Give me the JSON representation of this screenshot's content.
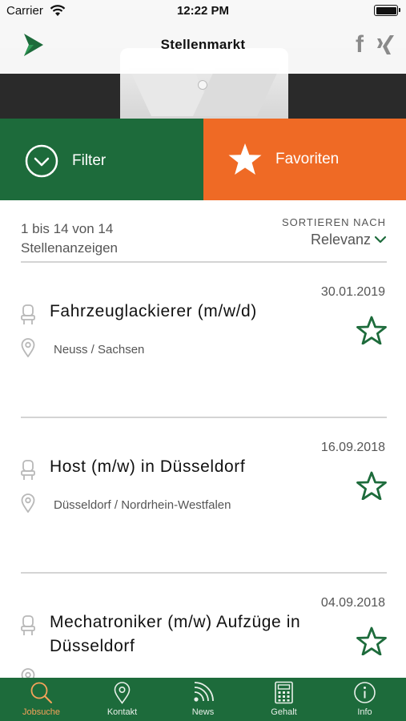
{
  "status_bar": {
    "carrier": "Carrier",
    "time": "12:22 PM"
  },
  "header": {
    "title": "Stellenmarkt",
    "facebook_glyph": "f"
  },
  "actions": {
    "filter_label": "Filter",
    "favorites_label": "Favoriten"
  },
  "summary": {
    "count_line1": "1 bis 14 von 14",
    "count_line2": "Stellenanzeigen",
    "sort_caption": "SORTIEREN NACH",
    "sort_value": "Relevanz"
  },
  "jobs": [
    {
      "date": "30.01.2019",
      "title": "Fahrzeuglackierer (m/w/d)",
      "location": "Neuss / Sachsen"
    },
    {
      "date": "16.09.2018",
      "title": "Host (m/w) in Düsseldorf",
      "location": "Düsseldorf / Nordrhein-Westfalen"
    },
    {
      "date": "04.09.2018",
      "title": "Mechatroniker (m/w) Aufzüge in Düsseldorf",
      "location": ""
    }
  ],
  "tabs": [
    {
      "label": "Jobsuche",
      "icon": "search-icon",
      "active": true
    },
    {
      "label": "Kontakt",
      "icon": "location-pin-icon",
      "active": false
    },
    {
      "label": "News",
      "icon": "rss-icon",
      "active": false
    },
    {
      "label": "Gehalt",
      "icon": "calculator-icon",
      "active": false
    },
    {
      "label": "Info",
      "icon": "info-icon",
      "active": false
    }
  ],
  "colors": {
    "green": "#1d6b3b",
    "orange": "#ef6a25",
    "active_tab": "#f6a25a"
  }
}
